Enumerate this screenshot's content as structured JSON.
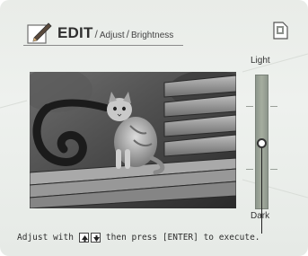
{
  "header": {
    "title": "EDIT",
    "separator": "/",
    "breadcrumb_1": "Adjust",
    "separator_2": "/",
    "breadcrumb_2": "Brightness",
    "edit_icon": "pencil-edit-icon",
    "card_icon": "memory-card-icon"
  },
  "preview": {
    "image": "cat-on-bench-photo"
  },
  "brightness_slider": {
    "top_label": "Light",
    "bottom_label": "Dark",
    "level": 0.49
  },
  "footer": {
    "instruction_prefix": "Adjust with",
    "keys_icon": "up-down-arrow-keys-icon",
    "instruction_suffix": "then press [ENTER] to execute."
  },
  "colors": {
    "background": "#eaede9",
    "slider": "#a5ad9f",
    "text": "#2f2f2f"
  }
}
